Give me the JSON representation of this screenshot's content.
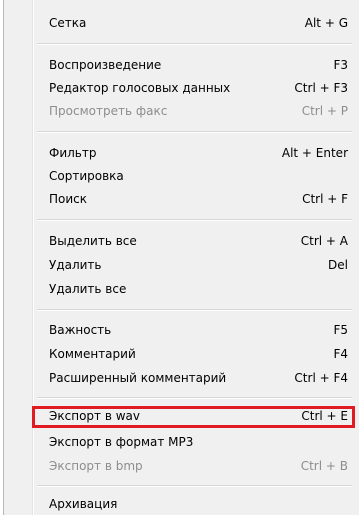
{
  "menu": {
    "items": [
      {
        "label": "Сетка",
        "shortcut": "Alt + G",
        "enabled": true
      },
      {
        "label": "Воспроизведение",
        "shortcut": "F3",
        "enabled": true
      },
      {
        "label": "Редактор голосовых данных",
        "shortcut": "Ctrl + F3",
        "enabled": true
      },
      {
        "label": "Просмотреть факс",
        "shortcut": "Ctrl + P",
        "enabled": false
      },
      {
        "label": "Фильтр",
        "shortcut": "Alt + Enter",
        "enabled": true
      },
      {
        "label": "Сортировка",
        "shortcut": "",
        "enabled": true
      },
      {
        "label": "Поиск",
        "shortcut": "Ctrl + F",
        "enabled": true
      },
      {
        "label": "Выделить все",
        "shortcut": "Ctrl + A",
        "enabled": true
      },
      {
        "label": "Удалить",
        "shortcut": "Del",
        "enabled": true
      },
      {
        "label": "Удалить все",
        "shortcut": "",
        "enabled": true
      },
      {
        "label": "Важность",
        "shortcut": "F5",
        "enabled": true
      },
      {
        "label": "Комментарий",
        "shortcut": "F4",
        "enabled": true
      },
      {
        "label": "Расширенный комментарий",
        "shortcut": "Ctrl + F4",
        "enabled": true
      },
      {
        "label": "Экспорт в wav",
        "shortcut": "Ctrl + E",
        "enabled": true,
        "highlighted": true
      },
      {
        "label": "Экспорт в формат MP3",
        "shortcut": "",
        "enabled": true
      },
      {
        "label": "Экспорт в bmp",
        "shortcut": "Ctrl + B",
        "enabled": false
      },
      {
        "label": "Архивация",
        "shortcut": "",
        "enabled": true
      }
    ]
  },
  "colors": {
    "menu_background": "#f0f0f0",
    "text": "#000000",
    "disabled_text": "#8d8d8d",
    "highlight_border": "#e11b22"
  }
}
